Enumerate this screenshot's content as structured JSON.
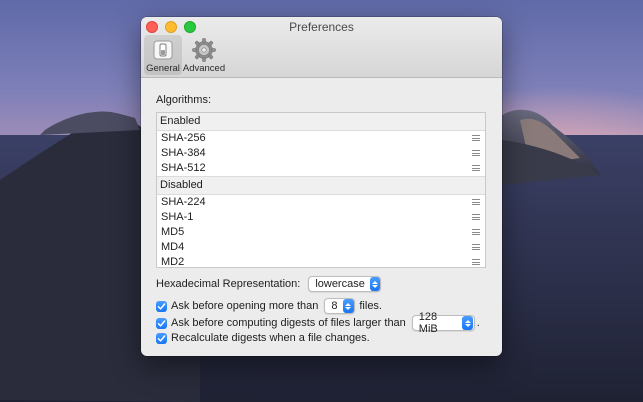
{
  "window": {
    "title": "Preferences"
  },
  "toolbar": {
    "items": [
      {
        "label": "General",
        "icon": "switch-icon",
        "active": true
      },
      {
        "label": "Advanced",
        "icon": "gear-icon",
        "active": false
      }
    ]
  },
  "algorithms": {
    "label": "Algorithms:",
    "enabled_header": "Enabled",
    "enabled": [
      "SHA-256",
      "SHA-384",
      "SHA-512"
    ],
    "disabled_header": "Disabled",
    "disabled": [
      "SHA-224",
      "SHA-1",
      "MD5",
      "MD4",
      "MD2"
    ]
  },
  "hex": {
    "label": "Hexadecimal Representation:",
    "value": "lowercase"
  },
  "options": {
    "ask_open_prefix": "Ask before opening more than",
    "ask_open_value": "8",
    "ask_open_suffix": "files.",
    "ask_compute_prefix": "Ask before computing digests of files larger than",
    "ask_compute_value": "128 MiB",
    "ask_compute_suffix": ".",
    "recalc": "Recalculate digests when a file changes."
  },
  "colors": {
    "accent": "#1a7cf5",
    "close": "#fe5f57",
    "minimize": "#febc2e",
    "zoom": "#28c840"
  }
}
